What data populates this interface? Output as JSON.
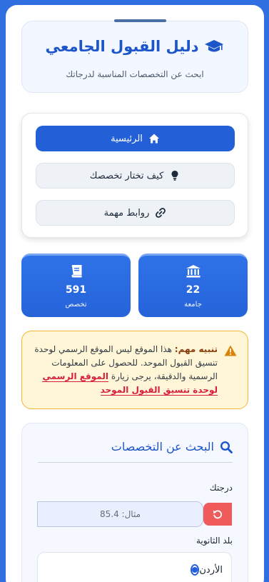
{
  "header": {
    "title": "دليل القبول الجامعي",
    "subtitle": "ابحث عن التخصصات المناسبة لدرجاتك",
    "icon": "graduation-cap-icon"
  },
  "nav": {
    "items": [
      {
        "label": "الرئيسية",
        "icon": "home-icon",
        "active": true
      },
      {
        "label": "كيف تختار تخصصك",
        "icon": "lightbulb-icon",
        "active": false
      },
      {
        "label": "روابط مهمة",
        "icon": "link-icon",
        "active": false
      }
    ]
  },
  "stats": [
    {
      "value": "22",
      "label": "جامعة",
      "icon": "university-icon"
    },
    {
      "value": "591",
      "label": "تخصص",
      "icon": "book-icon"
    }
  ],
  "warning": {
    "strong": "تنبيه مهم:",
    "text": "هذا الموقع ليس الموقع الرسمي لوحدة تنسيق القبول الموحد. للحصول على المعلومات الرسمية والدقيقة، يرجى زيارة",
    "link": "الموقع الرسمي لوحدة تنسيق القبول الموحد",
    "icon": "warning-icon"
  },
  "search": {
    "title": "البحث عن التخصصات",
    "icon": "search-icon",
    "grade_label": "درجتك",
    "grade_placeholder": "مثال: 85.4",
    "grade_value": "",
    "reset_icon": "reset-icon",
    "country_label": "بلد الثانوية",
    "country_selected": "الأردن"
  },
  "colors": {
    "primary": "#2360d8",
    "background": "#2f6fe0",
    "warning_border": "#f2b632",
    "link_red": "#d61f3c",
    "reset_red": "#ef5a5a"
  }
}
